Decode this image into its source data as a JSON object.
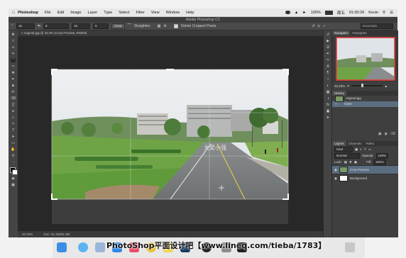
{
  "menubar": {
    "apple_icon": "apple-logo",
    "app_name": "Photoshop",
    "items": [
      "File",
      "Edit",
      "Image",
      "Layer",
      "Type",
      "Select",
      "Filter",
      "View",
      "Window",
      "Help"
    ],
    "battery": "100%",
    "date": "周五",
    "time": "01:00:26",
    "user": "Kevin"
  },
  "window": {
    "title": "Adobe Photoshop CC"
  },
  "options_bar": {
    "ratio_w": "16",
    "ratio_h": "9",
    "res": "16",
    "res2": "9",
    "clear_label": "Clear",
    "straighten_label": "Straighten",
    "delete_cropped_label": "Delete Cropped Pixels",
    "workspace": "Essentials"
  },
  "document": {
    "tab_title": "original.jpg @ 33.3% (Crop Preview, RGB/8)",
    "zoom": "33.33%",
    "doc_size": "Doc: 51.3M/51.3M"
  },
  "photo": {
    "overlay_logo_text": "大爱小强"
  },
  "navigator": {
    "tabs": [
      "Navigator",
      "Histogram"
    ],
    "zoom": "33.33%"
  },
  "history": {
    "tab": "History",
    "items": [
      {
        "label": "original.jpg"
      },
      {
        "label": "Open"
      }
    ]
  },
  "layers": {
    "tabs": [
      "Layers",
      "Channels",
      "Paths"
    ],
    "kind": "Kind",
    "blend": "Normal",
    "opacity_label": "Opacity:",
    "opacity": "100%",
    "lock_label": "Lock:",
    "fill_label": "Fill:",
    "fill": "100%",
    "items": [
      {
        "name": "Crop Preview"
      },
      {
        "name": "Background"
      }
    ]
  },
  "watermark": {
    "text": "PhotoShop平面设计吧【www.lineq.com/tieba/1783】"
  }
}
